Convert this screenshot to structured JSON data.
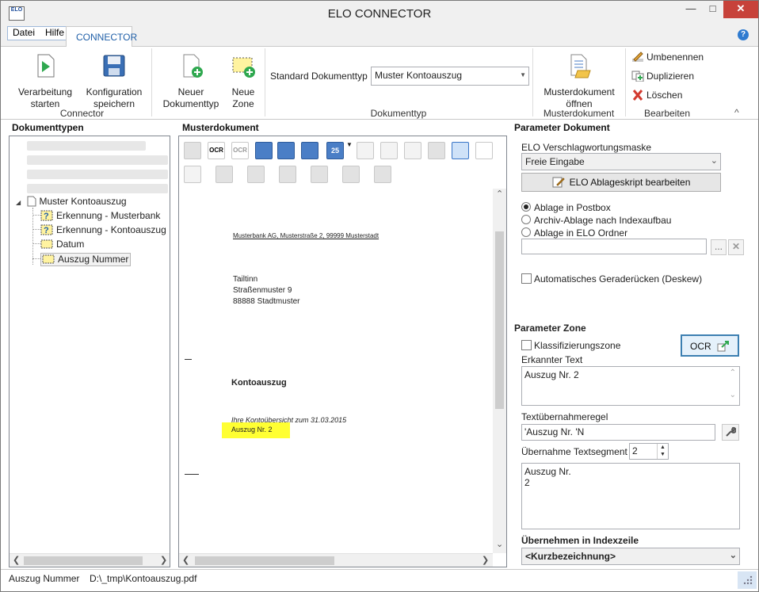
{
  "window": {
    "title": "ELO CONNECTOR",
    "icon_text": "ELO"
  },
  "menu": {
    "datei": "Datei",
    "hilfe": "Hilfe",
    "active_tab": "CONNECTOR",
    "help": "?"
  },
  "ribbon": {
    "verarbeitung": "Verarbeitung\nstarten",
    "verarbeitung_l1": "Verarbeitung",
    "verarbeitung_l2": "starten",
    "konfig_l1": "Konfiguration",
    "konfig_l2": "speichern",
    "group_connector": "Connector",
    "neuer_doktyp_l1": "Neuer",
    "neuer_doktyp_l2": "Dokumenttyp",
    "neue_zone_l1": "Neue",
    "neue_zone_l2": "Zone",
    "std_doktyp_label": "Standard Dokumenttyp",
    "std_doktyp_value": "Muster Kontoauszug",
    "group_dokumenttyp": "Dokumenttyp",
    "musterdok_l1": "Musterdokument",
    "musterdok_l2": "öffnen",
    "group_musterdokument": "Musterdokument",
    "umbenennen": "Umbenennen",
    "duplizieren": "Duplizieren",
    "loeschen": "Löschen",
    "group_bearbeiten": "Bearbeiten",
    "collapse": "^"
  },
  "left_pane": {
    "title": "Dokumenttypen",
    "tree": {
      "root": "Muster Kontoauszug",
      "children": [
        "Erkennung - Musterbank",
        "Erkennung - Kontoauszug",
        "Datum",
        "Auszug Nummer"
      ],
      "selected": "Auszug Nummer"
    }
  },
  "center_pane": {
    "title": "Musterdokument",
    "toolbar": {
      "ocr": "OCR",
      "page_num": "25"
    },
    "document": {
      "sender_line": "Musterbank AG, Musterstraße 2, 99999 Musterstadt",
      "address": [
        "Tailtinn",
        "Straßenmuster 9",
        "88888 Stadtmuster"
      ],
      "heading": "Kontoauszug",
      "overview": "Ihre Kontoübersicht zum 31.03.2015",
      "highlight": "Auszug Nr. 2",
      "highlight_color": "#ffff33"
    }
  },
  "right_pane": {
    "title": "Parameter Dokument",
    "maske_label": "ELO Verschlagwortungsmaske",
    "maske_value": "Freie Eingabe",
    "skript_button": "ELO Ablageskript bearbeiten",
    "radios": [
      "Ablage in Postbox",
      "Archiv-Ablage nach Indexaufbau",
      "Ablage in ELO Ordner"
    ],
    "radio_selected": "Ablage in Postbox",
    "ordner_value": "",
    "browse": "...",
    "deskew": "Automatisches Geraderücken (Deskew)",
    "zone_title": "Parameter Zone",
    "klassifizierung": "Klassifizierungszone",
    "ocr_button": "OCR",
    "erkannter_label": "Erkannter Text",
    "erkannter_value": "Auszug Nr. 2",
    "regel_label": "Textübernahmeregel",
    "regel_value": "'Auszug Nr. 'N",
    "segment_label": "Übernahme Textsegment",
    "segment_value": "2",
    "result_lines": [
      "Auszug Nr.",
      "2"
    ],
    "index_title": "Übernehmen in Indexzeile",
    "index_value": "<Kurzbezeichnung>"
  },
  "status": {
    "left": "Auszug Nummer",
    "path": "D:\\_tmp\\Kontoauszug.pdf"
  },
  "colors": {
    "accent": "#1f5fa8",
    "close": "#c7423a"
  }
}
